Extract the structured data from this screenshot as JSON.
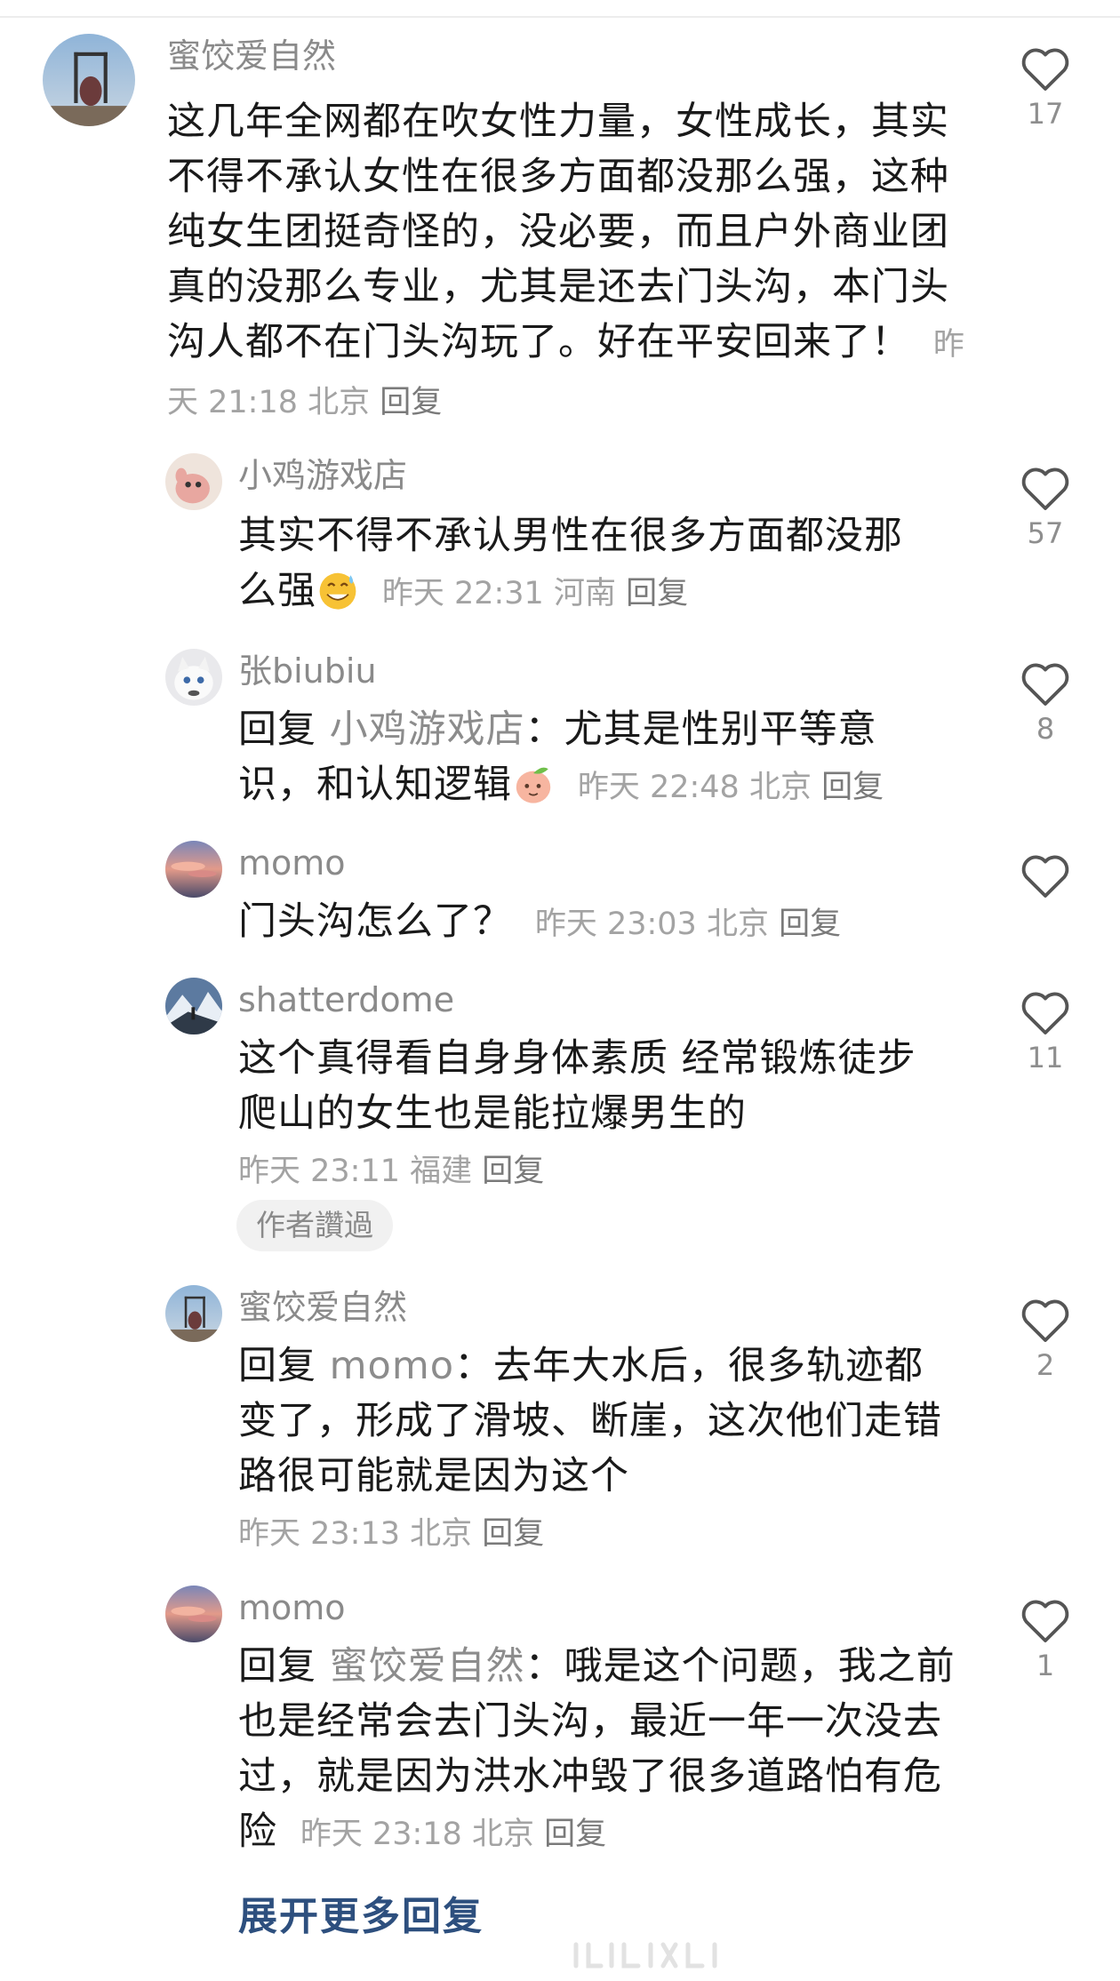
{
  "comments": [
    {
      "user": "蜜饺爱自然",
      "text": "这几年全网都在吹女性力量，女性成长，其实不得不承认女性在很多方面都没那么强，这种纯女生团挺奇怪的，没必要，而且户外商业团真的没那么专业，尤其是还去门头沟，本门头沟人都不在门头沟玩了。好在平安回来了！",
      "time": "昨天 21:18",
      "location": "北京",
      "reply_label": "回复",
      "likes": "17"
    },
    {
      "user": "小鸡游戏店",
      "text": "其实不得不承认男性在很多方面都没那么强",
      "emoji": "sweat-smile-emoji",
      "time": "昨天 22:31",
      "location": "河南",
      "reply_label": "回复",
      "likes": "57"
    },
    {
      "user": "张biubiu",
      "reply_prefix": "回复",
      "reply_to": "小鸡游戏店",
      "text": "：尤其是性别平等意识，和认知逻辑",
      "emoji": "peach-face-emoji",
      "time": "昨天 22:48",
      "location": "北京",
      "reply_label": "回复",
      "likes": "8"
    },
    {
      "user": "momo",
      "text": "门头沟怎么了？",
      "time": "昨天 23:03",
      "location": "北京",
      "reply_label": "回复",
      "likes": ""
    },
    {
      "user": "shatterdome",
      "text": "这个真得看自身身体素质 经常锻炼徒步爬山的女生也是能拉爆男生的",
      "time": "昨天 23:11",
      "location": "福建",
      "reply_label": "回复",
      "badge": "作者讚過",
      "likes": "11"
    },
    {
      "user": "蜜饺爱自然",
      "reply_prefix": "回复",
      "reply_to": "momo",
      "text": "：去年大水后，很多轨迹都变了，形成了滑坡、断崖，这次他们走错路很可能就是因为这个",
      "time": "昨天 23:13",
      "location": "北京",
      "reply_label": "回复",
      "likes": "2"
    },
    {
      "user": "momo",
      "reply_prefix": "回复",
      "reply_to": "蜜饺爱自然",
      "text": "：哦是这个问题，我之前也是经常会去门头沟，最近一年一次没去过，就是因为洪水冲毁了很多道路怕有危险",
      "time": "昨天 23:18",
      "location": "北京",
      "reply_label": "回复",
      "likes": "1"
    }
  ],
  "expand_label": "展开更多回复",
  "colors": {
    "username": "#8a8a8a",
    "meta": "#a3a3a3",
    "link": "#2d4f7e"
  }
}
